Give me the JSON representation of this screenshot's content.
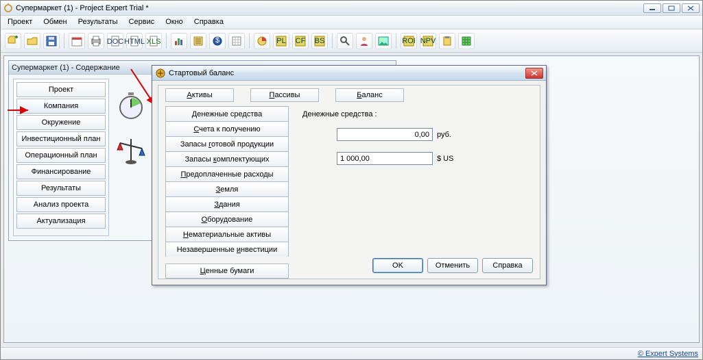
{
  "window": {
    "title": "Супермаркет (1) - Project Expert Trial *"
  },
  "menu": [
    "Проект",
    "Обмен",
    "Результаты",
    "Сервис",
    "Окно",
    "Справка"
  ],
  "child_window": {
    "title": "Супермаркет (1) - Содержание"
  },
  "sidebar": {
    "items": [
      "Проект",
      "Компания",
      "Окружение",
      "Инвестиционный план",
      "Операционный план",
      "Финансирование",
      "Результаты",
      "Анализ проекта",
      "Актуализация"
    ]
  },
  "dialog": {
    "title": "Стартовый баланс",
    "tabs": [
      "Активы",
      "Пассивы",
      "Баланс"
    ],
    "tab_accel": [
      "А",
      "П",
      "Б"
    ],
    "subitems": [
      {
        "label": "Денежные средства",
        "accel": "Д"
      },
      {
        "label": "Счета к получению",
        "accel": "С"
      },
      {
        "label": "Запасы готовой продукции",
        "accel": "г"
      },
      {
        "label": "Запасы комплектующих",
        "accel": "к"
      },
      {
        "label": "Предоплаченные расходы",
        "accel": "П"
      },
      {
        "label": "Земля",
        "accel": "З"
      },
      {
        "label": "Здания",
        "accel": "З"
      },
      {
        "label": "Оборудование",
        "accel": "О"
      },
      {
        "label": "Нематериальные активы",
        "accel": "Н"
      },
      {
        "label": "Незавершенные инвестиции",
        "accel": "и"
      },
      {
        "label": "Ценные бумаги",
        "accel": "Ц"
      }
    ],
    "form": {
      "heading": "Денежные средства :",
      "value_rub": "0,00",
      "unit_rub": "руб.",
      "value_usd": "1 000,00",
      "unit_usd": "$ US"
    },
    "buttons": {
      "ok": "OK",
      "cancel": "Отменить",
      "help": "Справка"
    }
  },
  "status": {
    "link": "© Expert Systems"
  },
  "toolbar_icons": [
    "folder-plus",
    "folder",
    "save",
    "sep",
    "calendar",
    "print",
    "doc",
    "html",
    "xls",
    "sep",
    "chart",
    "list",
    "disc",
    "grid-cal",
    "sep",
    "pie",
    "pl",
    "cf",
    "bs",
    "sep",
    "zoom",
    "user",
    "picture",
    "sep",
    "roi",
    "npv",
    "clipboard",
    "table"
  ]
}
